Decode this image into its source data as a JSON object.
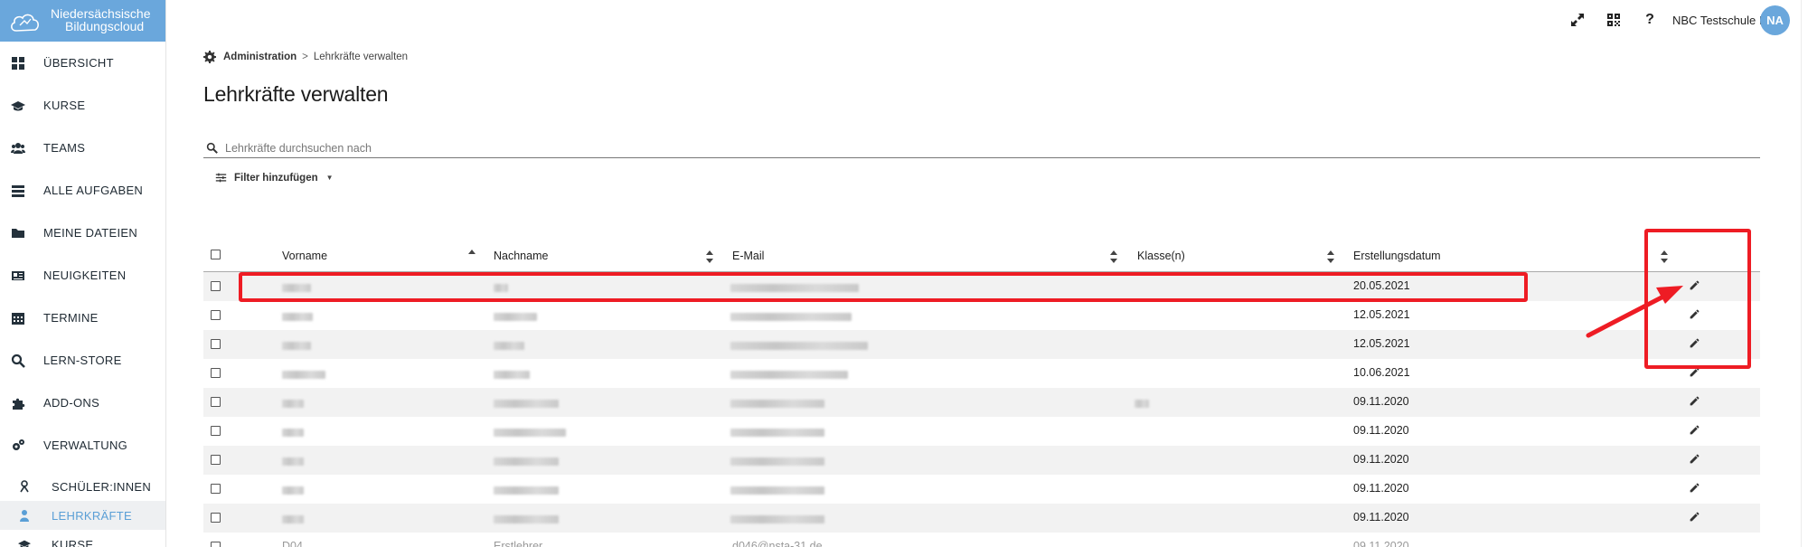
{
  "brand": {
    "line1": "Niedersächsische",
    "line2_a": "Bildungs",
    "line2_b": "cloud"
  },
  "sidebar": {
    "items": [
      {
        "label": "ÜBERSICHT",
        "icon": "dashboard-icon"
      },
      {
        "label": "KURSE",
        "icon": "graduation-cap-icon"
      },
      {
        "label": "TEAMS",
        "icon": "team-icon"
      },
      {
        "label": "ALLE AUFGABEN",
        "icon": "tasks-icon"
      },
      {
        "label": "MEINE DATEIEN",
        "icon": "folder-icon"
      },
      {
        "label": "NEUIGKEITEN",
        "icon": "newspaper-icon"
      },
      {
        "label": "TERMINE",
        "icon": "calendar-icon"
      },
      {
        "label": "LERN-STORE",
        "icon": "search-icon"
      },
      {
        "label": "ADD-ONS",
        "icon": "puzzle-icon"
      },
      {
        "label": "VERWALTUNG",
        "icon": "cogs-icon"
      }
    ],
    "subitems": [
      {
        "label": "SCHÜLER:INNEN",
        "icon": "student-icon"
      },
      {
        "label": "LEHRKRÄFTE",
        "icon": "teacher-icon",
        "active": true
      },
      {
        "label": "KURSE",
        "icon": "graduation-cap-icon"
      }
    ]
  },
  "topbar": {
    "school": "NBC Testschule I",
    "avatar": "NA",
    "icons": [
      "fullscreen-icon",
      "qr-code-icon",
      "help-icon"
    ],
    "help_glyph": "?"
  },
  "breadcrumb": {
    "parent": "Administration",
    "separator": ">",
    "current": "Lehrkräfte verwalten"
  },
  "page_title": "Lehrkräfte verwalten",
  "search": {
    "placeholder": "Lehrkräfte durchsuchen nach",
    "value": ""
  },
  "filter": {
    "label": "Filter hinzufügen"
  },
  "table": {
    "columns": [
      "Vorname",
      "Nachname",
      "E-Mail",
      "Klasse(n)",
      "Erstellungsdatum"
    ],
    "rows": [
      {
        "date": "20.05.2021"
      },
      {
        "date": "12.05.2021"
      },
      {
        "date": "12.05.2021"
      },
      {
        "date": "10.06.2021"
      },
      {
        "date": "09.11.2020"
      },
      {
        "date": "09.11.2020"
      },
      {
        "date": "09.11.2020"
      },
      {
        "date": "09.11.2020"
      },
      {
        "date": "09.11.2020"
      }
    ],
    "partial_row": {
      "vorname": "D04",
      "nachname": "Erstlehrer",
      "email": "d046@nsta-31.de",
      "date": "09.11.2020"
    }
  },
  "colors": {
    "brand": "#6aa7dc",
    "annotation": "#ee1c24",
    "active_text": "#5a9fd6"
  }
}
